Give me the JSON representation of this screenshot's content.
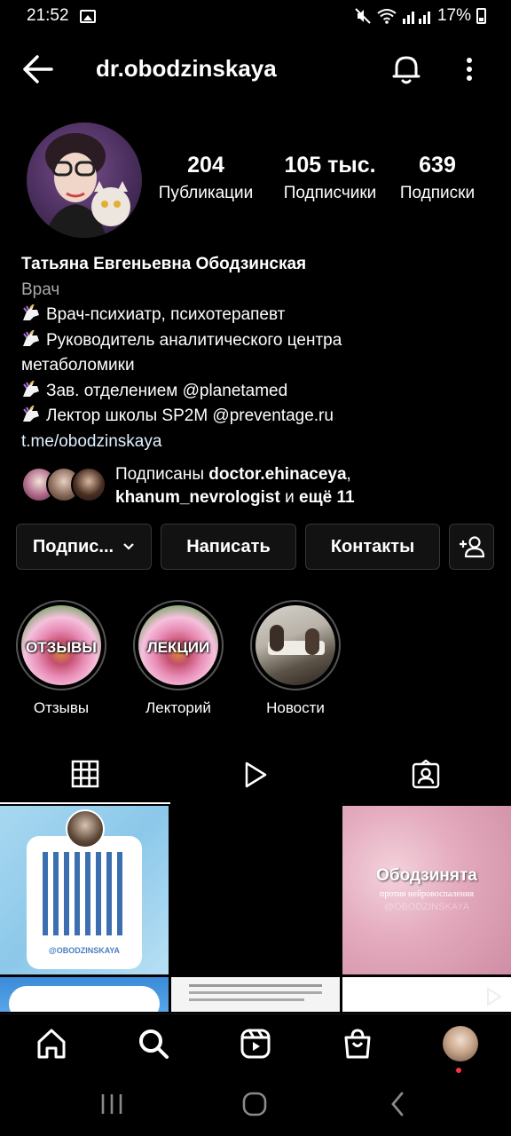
{
  "status_bar": {
    "time": "21:52",
    "battery": "17%"
  },
  "header": {
    "username": "dr.obodzinskaya"
  },
  "profile": {
    "stats": [
      {
        "value": "204",
        "label": "Публикации"
      },
      {
        "value": "105 тыс.",
        "label": "Подписчики"
      },
      {
        "value": "639",
        "label": "Подписки"
      }
    ],
    "name": "Татьяна Евгеньевна Ободзинская",
    "category": "Врач",
    "bio_lines": [
      "Врач-психиатр, психотерапевт",
      "Руководитель аналитического центра",
      "метаболомики",
      "Зав. отделением  @planetamed",
      "Лектор школы SP2M @preventage.ru"
    ],
    "link": "t.me/obodzinskaya"
  },
  "followed_by": {
    "prefix": "Подписаны ",
    "user1": "doctor.ehinaceya",
    "separator": ",",
    "user2": "khanum_nevrologist",
    "middle": " и ",
    "more": "ещё 11"
  },
  "actions": {
    "following": "Подпис...",
    "message": "Написать",
    "contacts": "Контакты"
  },
  "highlights": [
    {
      "label": "Отзывы",
      "cover_text": "ОТЗЫВЫ"
    },
    {
      "label": "Лекторий",
      "cover_text": "ЛЕКЦИИ"
    },
    {
      "label": "Новости",
      "cover_text": ""
    }
  ],
  "posts": {
    "qr": {
      "handle": "@OBODZINSKAYA"
    },
    "pink": {
      "title": "Ободзинята",
      "subtitle": "против нейровоспаления",
      "watermark": "@OBODZINSKAYA"
    }
  },
  "colors": {
    "background": "#000000",
    "border": "#363636",
    "notification": "#ff3040",
    "link": "#e0f1ff"
  }
}
